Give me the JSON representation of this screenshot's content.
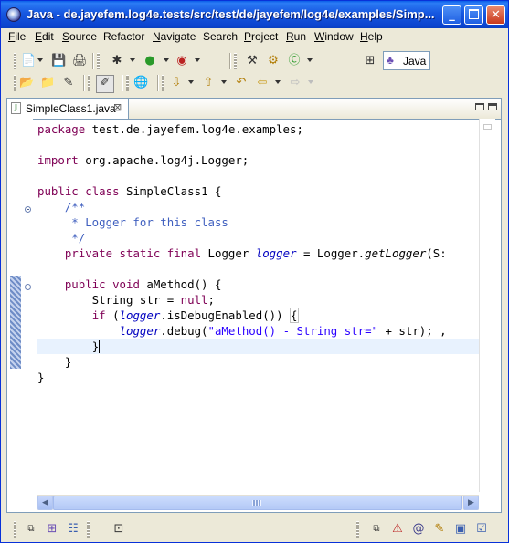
{
  "window": {
    "title": "Java - de.jayefem.log4e.tests/src/test/de/jayefem/log4e/examples/Simp..."
  },
  "menubar": {
    "items": [
      {
        "label": "File",
        "mnemonic": "F",
        "rest": "ile"
      },
      {
        "label": "Edit",
        "mnemonic": "E",
        "rest": "dit"
      },
      {
        "label": "Source",
        "mnemonic": "S",
        "rest": "ource"
      },
      {
        "label": "Refactor",
        "mnemonic": "",
        "rest": "Refactor"
      },
      {
        "label": "Navigate",
        "mnemonic": "N",
        "rest": "avigate"
      },
      {
        "label": "Search",
        "mnemonic": "",
        "rest": "Search"
      },
      {
        "label": "Project",
        "mnemonic": "P",
        "rest": "roject"
      },
      {
        "label": "Run",
        "mnemonic": "R",
        "rest": "un"
      },
      {
        "label": "Window",
        "mnemonic": "W",
        "rest": "indow"
      },
      {
        "label": "Help",
        "mnemonic": "H",
        "rest": "elp"
      }
    ]
  },
  "perspective": {
    "label": "Java",
    "icon": "java-perspective-icon"
  },
  "editor": {
    "tab_label": "SimpleClass1.java",
    "code": {
      "l1_kw": "package",
      "l1_rest": " test.de.jayefem.log4e.examples;",
      "l3_kw": "import",
      "l3_rest": " org.apache.log4j.Logger;",
      "l5_kw1": "public",
      "l5_kw2": "class",
      "l5_rest": " SimpleClass1 {",
      "l6": "    /**",
      "l7": "     * Logger for this class",
      "l8": "     */",
      "l9_kw1": "private",
      "l9_kw2": "static",
      "l9_kw3": "final",
      "l9_type": " Logger ",
      "l9_field": "logger",
      "l9_mid": " = Logger.",
      "l9_method": "getLogger",
      "l9_tail": "(S:",
      "l11_kw1": "public",
      "l11_kw2": "void",
      "l11_rest": " aMethod() {",
      "l12_a": "        String str = ",
      "l12_kw": "null",
      "l12_b": ";",
      "l13_kw": "if",
      "l13_a": " (",
      "l13_field": "logger",
      "l13_b": ".isDebugEnabled()) ",
      "l13_brace": "{",
      "l14_field": "logger",
      "l14_a": ".debug(",
      "l14_str": "\"aMethod() - String str=\"",
      "l14_b": " + str); ,",
      "l15": "}",
      "l16": "    }",
      "l17": "}"
    }
  },
  "colors": {
    "keyword": "#7f0055",
    "comment": "#3f5fbf",
    "string": "#2a00ff",
    "field": "#0000c0",
    "title_bar": "#0b44cf",
    "current_line": "#e8f2fe"
  }
}
